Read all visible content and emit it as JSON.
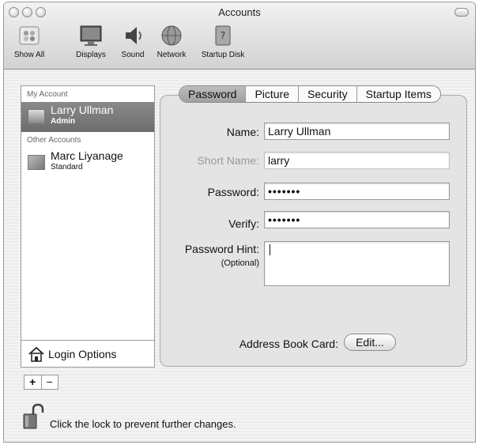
{
  "window": {
    "title": "Accounts"
  },
  "toolbar": {
    "items": [
      {
        "label": "Show All",
        "icon": "show-all-icon"
      },
      {
        "label": "Displays",
        "icon": "displays-icon"
      },
      {
        "label": "Sound",
        "icon": "sound-icon"
      },
      {
        "label": "Network",
        "icon": "network-icon"
      },
      {
        "label": "Startup Disk",
        "icon": "startup-disk-icon"
      }
    ]
  },
  "sidebar": {
    "my_account_header": "My Account",
    "my_account": {
      "name": "Larry Ullman",
      "role": "Admin"
    },
    "other_accounts_header": "Other Accounts",
    "other_accounts": [
      {
        "name": "Marc Liyanage",
        "role": "Standard"
      }
    ],
    "login_options": "Login Options"
  },
  "controls": {
    "add": "+",
    "remove": "−"
  },
  "tabs": [
    {
      "label": "Password",
      "active": true
    },
    {
      "label": "Picture",
      "active": false
    },
    {
      "label": "Security",
      "active": false
    },
    {
      "label": "Startup Items",
      "active": false
    }
  ],
  "form": {
    "name_label": "Name:",
    "name_value": "Larry Ullman",
    "short_name_label": "Short Name:",
    "short_name_value": "larry",
    "password_label": "Password:",
    "password_value": "•••••••",
    "verify_label": "Verify:",
    "verify_value": "•••••••",
    "hint_label": "Password Hint:",
    "hint_optional": "(Optional)",
    "hint_value": "",
    "address_book_label": "Address Book Card:",
    "edit_button": "Edit..."
  },
  "footer": {
    "lock_text": "Click the lock to prevent further changes."
  }
}
